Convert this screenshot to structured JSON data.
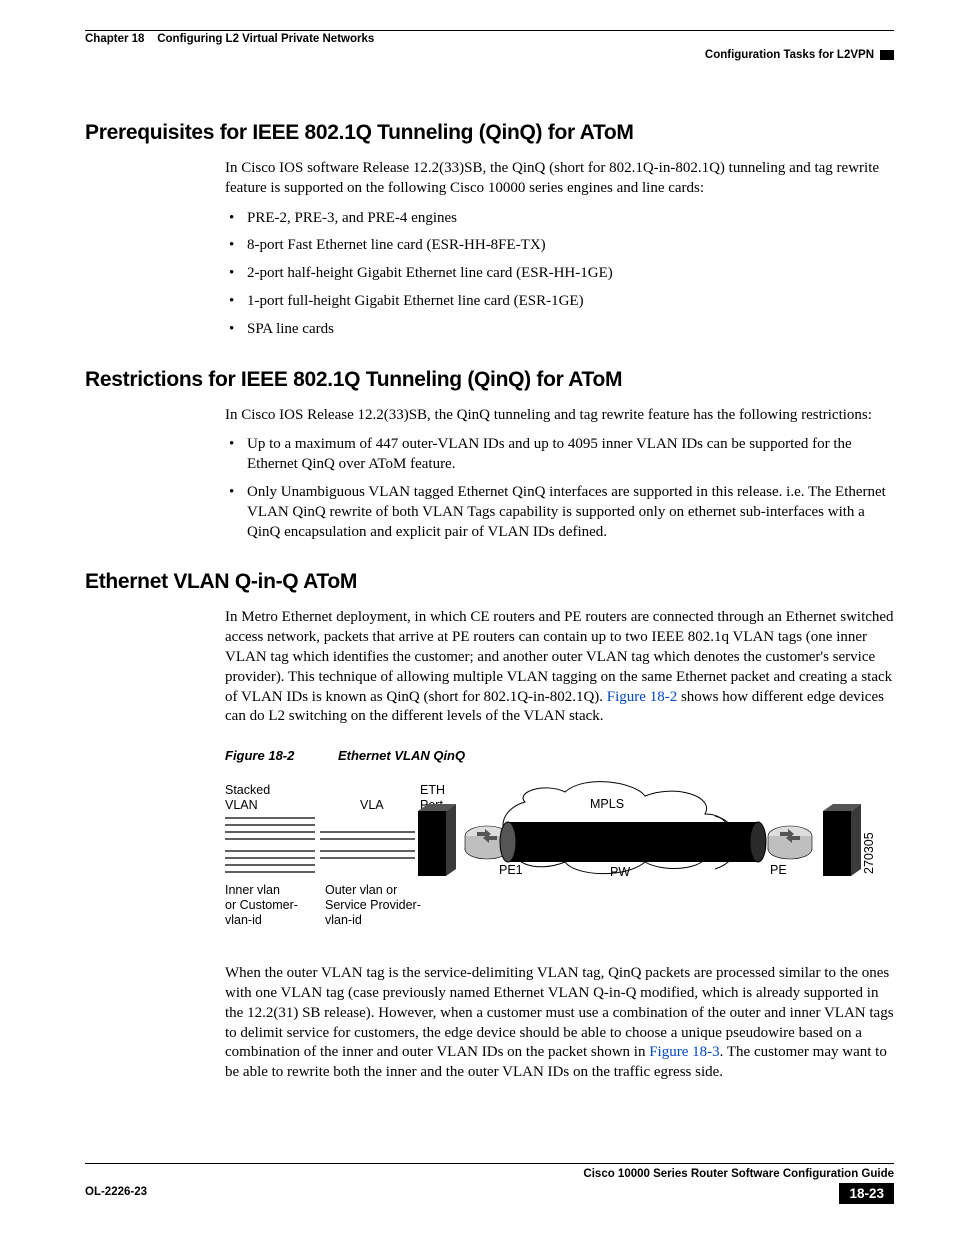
{
  "header": {
    "chapter": "Chapter 18",
    "chapter_title": "Configuring L2 Virtual Private Networks",
    "right_label": "Configuration Tasks for L2VPN"
  },
  "sections": {
    "prereq": {
      "title": "Prerequisites for IEEE 802.1Q Tunneling (QinQ) for AToM",
      "intro": "In Cisco IOS software Release 12.2(33)SB, the QinQ (short for 802.1Q-in-802.1Q) tunneling and tag rewrite feature is supported on the following Cisco 10000 series engines and line cards:",
      "bullets": [
        "PRE-2, PRE-3, and PRE-4 engines",
        "8-port Fast Ethernet line card (ESR-HH-8FE-TX)",
        "2-port half-height Gigabit Ethernet line card (ESR-HH-1GE)",
        "1-port full-height Gigabit Ethernet line card (ESR-1GE)",
        "SPA line cards"
      ]
    },
    "restrict": {
      "title": "Restrictions for IEEE 802.1Q Tunneling (QinQ) for AToM",
      "intro": "In Cisco IOS Release 12.2(33)SB, the QinQ tunneling and tag rewrite feature has the following restrictions:",
      "bullets": [
        "Up to a maximum of 447 outer-VLAN IDs and up to 4095 inner VLAN IDs can be supported for the Ethernet QinQ over AToM feature.",
        "Only Unambiguous VLAN tagged Ethernet QinQ interfaces are supported in this release. i.e.  The Ethernet VLAN QinQ rewrite of both VLAN Tags capability is supported only on ethernet sub-interfaces with a QinQ encapsulation and explicit pair of VLAN IDs defined."
      ]
    },
    "qinq": {
      "title": "Ethernet VLAN Q-in-Q AToM",
      "p1a": "In Metro Ethernet deployment, in which CE routers and PE routers are connected through an Ethernet switched access network, packets that arrive at PE routers can contain up to two IEEE 802.1q VLAN tags (one inner VLAN tag which identifies the customer; and another outer VLAN tag which denotes the customer's service provider). This technique of allowing multiple VLAN tagging on the same Ethernet packet and creating a stack of VLAN IDs is known as QinQ (short for 802.1Q-in-802.1Q). ",
      "p1_link": "Figure 18-2",
      "p1b": " shows how different edge devices can do L2 switching on the different levels of the VLAN stack.",
      "p2a": "When the outer VLAN tag is the service-delimiting VLAN tag, QinQ packets are processed similar to the ones with one VLAN tag (case previously named Ethernet VLAN Q-in-Q modified, which is already supported in the 12.2(31) SB release). However, when a customer must use a combination of the outer and inner VLAN tags to delimit service for customers, the edge device should be able to choose a unique pseudowire based on a combination of the inner and outer VLAN IDs on the packet shown in ",
      "p2_link": "Figure 18-3",
      "p2b": ". The customer may want to be able to rewrite both the inner and the outer VLAN IDs on the traffic egress side."
    }
  },
  "figure": {
    "label": "Figure 18-2",
    "title": "Ethernet VLAN QinQ",
    "labels": {
      "stacked_vlan": "Stacked\nVLAN",
      "vla": "VLA",
      "eth_port": "ETH\nPort",
      "mpls": "MPLS",
      "pe1": "PE1",
      "pw": "PW",
      "pe_r": "PE",
      "inner": "Inner vlan\nor Customer-\nvlan-id",
      "outer": "Outer vlan or\nService Provider-\nvlan-id",
      "code": "270305"
    }
  },
  "footer": {
    "guide": "Cisco 10000 Series Router Software Configuration Guide",
    "doc_id": "OL-2226-23",
    "page": "18-23"
  }
}
